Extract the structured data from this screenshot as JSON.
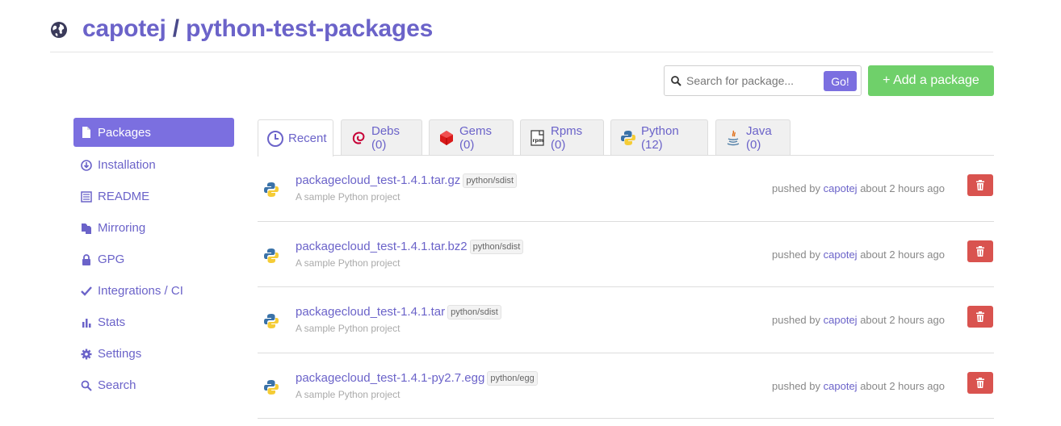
{
  "header": {
    "owner": "capotej",
    "separator": "/",
    "repo": "python-test-packages",
    "icon": "globe-icon"
  },
  "search": {
    "placeholder": "Search for package...",
    "value": "",
    "go_label": "Go!"
  },
  "add_package_label": "+ Add a package",
  "sidebar": {
    "items": [
      {
        "label": "Packages",
        "icon": "file-icon",
        "active": true
      },
      {
        "label": "Installation",
        "icon": "download-icon"
      },
      {
        "label": "README",
        "icon": "list-icon"
      },
      {
        "label": "Mirroring",
        "icon": "copy-icon"
      },
      {
        "label": "GPG",
        "icon": "lock-icon"
      },
      {
        "label": "Integrations / CI",
        "icon": "checkmark-icon"
      },
      {
        "label": "Stats",
        "icon": "bar-chart-icon"
      },
      {
        "label": "Settings",
        "icon": "gear-icon"
      },
      {
        "label": "Search",
        "icon": "search-icon"
      }
    ]
  },
  "tabs": [
    {
      "label": "Recent",
      "icon": "clock-icon",
      "active": true
    },
    {
      "label": "Debs (0)",
      "icon": "debian-icon"
    },
    {
      "label": "Gems (0)",
      "icon": "ruby-icon"
    },
    {
      "label": "Rpms (0)",
      "icon": "rpm-icon"
    },
    {
      "label": "Python (12)",
      "icon": "python-icon"
    },
    {
      "label": "Java (0)",
      "icon": "java-icon"
    }
  ],
  "packages": [
    {
      "name": "packagecloud_test-1.4.1.tar.gz",
      "type": "python/sdist",
      "description": "A sample Python project",
      "pushed_prefix": "pushed by",
      "user": "capotej",
      "time": "about 2 hours ago"
    },
    {
      "name": "packagecloud_test-1.4.1.tar.bz2",
      "type": "python/sdist",
      "description": "A sample Python project",
      "pushed_prefix": "pushed by",
      "user": "capotej",
      "time": "about 2 hours ago"
    },
    {
      "name": "packagecloud_test-1.4.1.tar",
      "type": "python/sdist",
      "description": "A sample Python project",
      "pushed_prefix": "pushed by",
      "user": "capotej",
      "time": "about 2 hours ago"
    },
    {
      "name": "packagecloud_test-1.4.1-py2.7.egg",
      "type": "python/egg",
      "description": "A sample Python project",
      "pushed_prefix": "pushed by",
      "user": "capotej",
      "time": "about 2 hours ago"
    }
  ],
  "colors": {
    "accent": "#7b6fe0",
    "link": "#6b63c9",
    "success": "#6fd06a",
    "danger": "#d9534f"
  }
}
